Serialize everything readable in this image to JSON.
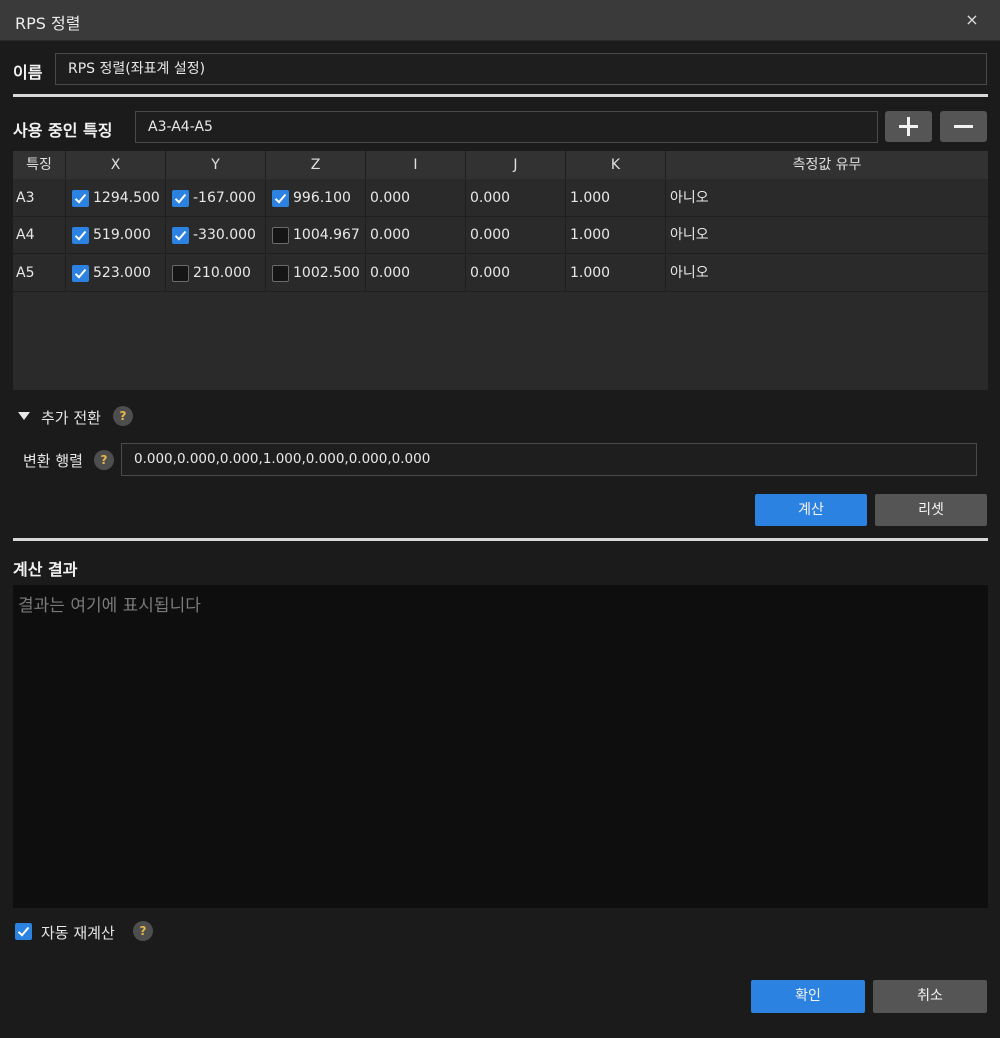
{
  "window": {
    "title": "RPS 정렬",
    "close_glyph": "×"
  },
  "name": {
    "label": "이름",
    "value": "RPS 정렬(좌표계 설정)"
  },
  "features": {
    "label": "사용 중인 특징",
    "value": "A3-A4-A5"
  },
  "table": {
    "headers": [
      "특징",
      "X",
      "Y",
      "Z",
      "I",
      "J",
      "K",
      "측정값 유무"
    ],
    "rows": [
      {
        "feature": "A3",
        "x": "1294.500",
        "x_checked": true,
        "y": "-167.000",
        "y_checked": true,
        "z": "996.100",
        "z_checked": true,
        "i": "0.000",
        "j": "0.000",
        "k": "1.000",
        "measured": "아니오"
      },
      {
        "feature": "A4",
        "x": "519.000",
        "x_checked": true,
        "y": "-330.000",
        "y_checked": true,
        "z": "1004.967",
        "z_checked": false,
        "i": "0.000",
        "j": "0.000",
        "k": "1.000",
        "measured": "아니오"
      },
      {
        "feature": "A5",
        "x": "523.000",
        "x_checked": true,
        "y": "210.000",
        "y_checked": false,
        "z": "1002.500",
        "z_checked": false,
        "i": "0.000",
        "j": "0.000",
        "k": "1.000",
        "measured": "아니오"
      }
    ]
  },
  "transform": {
    "section_label": "추가 전환",
    "matrix_label": "변환 행렬",
    "matrix_value": "0.000,0.000,0.000,1.000,0.000,0.000,0.000",
    "help_glyph": "?"
  },
  "actions": {
    "calculate": "계산",
    "reset": "리셋"
  },
  "result": {
    "label": "계산 결과",
    "placeholder": "결과는 여기에 표시됩니다"
  },
  "auto_recalc": {
    "label": "자동 재계산",
    "checked": true
  },
  "footer": {
    "ok": "확인",
    "cancel": "취소"
  },
  "colors": {
    "accent": "#2b82e0",
    "secondary_button": "#555555",
    "help_mark": "#e8b84a"
  }
}
